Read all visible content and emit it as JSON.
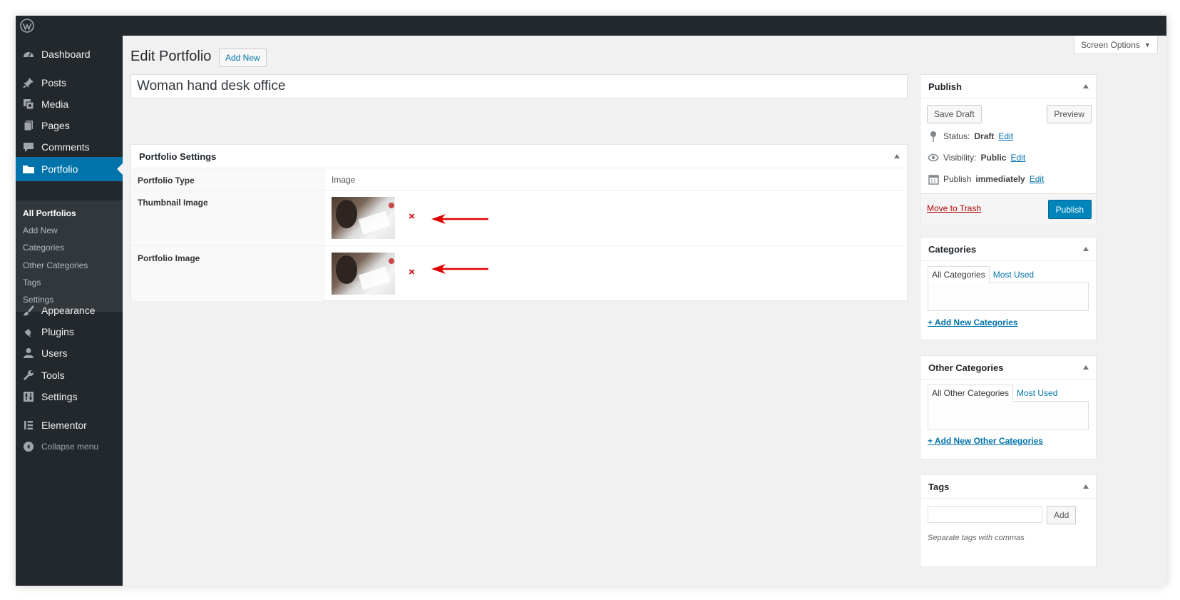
{
  "admin_bar": {
    "logo_icon": "wordpress-logo-icon"
  },
  "sidebar": {
    "items": [
      {
        "label": "Dashboard",
        "icon": "dashboard-icon"
      },
      {
        "label": "Posts",
        "icon": "pin-icon"
      },
      {
        "label": "Media",
        "icon": "media-icon"
      },
      {
        "label": "Pages",
        "icon": "pages-icon"
      },
      {
        "label": "Comments",
        "icon": "comment-icon"
      },
      {
        "label": "Portfolio",
        "icon": "folder-icon",
        "active": true
      },
      {
        "label": "Appearance",
        "icon": "brush-icon"
      },
      {
        "label": "Plugins",
        "icon": "plugin-icon"
      },
      {
        "label": "Users",
        "icon": "user-icon"
      },
      {
        "label": "Tools",
        "icon": "wrench-icon"
      },
      {
        "label": "Settings",
        "icon": "settings-icon"
      },
      {
        "label": "Elementor",
        "icon": "elementor-icon"
      },
      {
        "label": "Collapse menu",
        "icon": "collapse-icon"
      }
    ],
    "submenu": [
      "All Portfolios",
      "Add New",
      "Categories",
      "Other Categories",
      "Tags",
      "Settings"
    ]
  },
  "header": {
    "screen_options": "Screen Options",
    "title": "Edit Portfolio",
    "add_new": "Add New"
  },
  "post_title": "Woman hand desk office",
  "portfolio_settings": {
    "title": "Portfolio Settings",
    "rows": [
      {
        "label": "Portfolio Type",
        "value": "Image"
      },
      {
        "label": "Thumbnail Image",
        "remove": "×"
      },
      {
        "label": "Portfolio Image",
        "remove": "×"
      }
    ]
  },
  "publish": {
    "title": "Publish",
    "save_draft": "Save Draft",
    "preview": "Preview",
    "status_label": "Status:",
    "status_value": "Draft",
    "visibility_label": "Visibility:",
    "visibility_value": "Public",
    "publish_label": "Publish",
    "publish_value": "immediately",
    "edit": "Edit",
    "move_to_trash": "Move to Trash",
    "publish_button": "Publish"
  },
  "categories": {
    "title": "Categories",
    "tab_all": "All Categories",
    "tab_most_used": "Most Used",
    "add_new": "+ Add New Categories"
  },
  "other_categories": {
    "title": "Other Categories",
    "tab_all": "All Other Categories",
    "tab_most_used": "Most Used",
    "add_new": "+ Add New Other Categories"
  },
  "tags": {
    "title": "Tags",
    "add_button": "Add",
    "hint": "Separate tags with commas"
  },
  "colors": {
    "admin_dark": "#23282d",
    "accent": "#0073aa",
    "publish_blue": "#0085ba",
    "trash_red": "#a00",
    "arrow_red": "#e00000"
  }
}
